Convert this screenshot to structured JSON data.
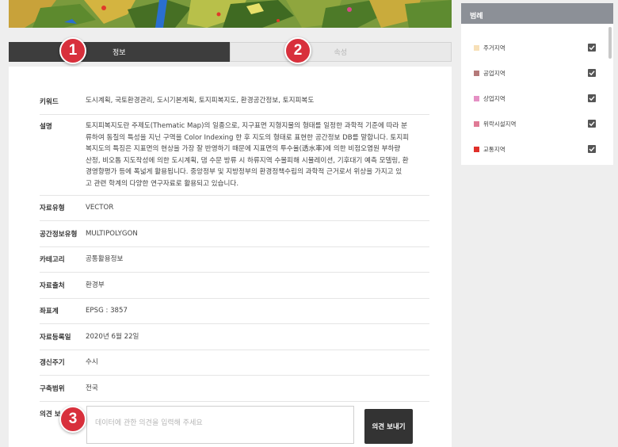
{
  "tabs": [
    {
      "label": "정보"
    },
    {
      "label": "속성"
    }
  ],
  "badges": [
    "1",
    "2",
    "3"
  ],
  "info": {
    "keyword": {
      "key": "키워드",
      "value": "도시계획, 국토환경관리, 도시기본계획, 토지피복지도, 환경공간정보, 토지피복도"
    },
    "description": {
      "key": "설명",
      "lines": [
        "토지피복지도란 주제도(Thematic Map)의 일종으로, 지구표면 지형지물의 형태를 일정한 과학적 기준에 따라 분",
        "류하여 동질의 특성을 지닌 구역을 Color Indexing 한 후 지도의 형태로 표현한 공간정보 DB를 말합니다. 토지피",
        "복지도의 특징은 지표면의 현상을 가장 잘 반영하기 때문에 지표면의 투수율(透水率)에 의한 비점오염원 부하량",
        "산정, 비오톱 지도작성에 의한 도시계획, 댐 수문 방류 시 하류지역 수몰피해 시뮬레이션, 기후대기 예측 모델링, 환",
        "경영향평가 등에 폭넓게 활용됩니다. 중앙정부 및 지방정부의 환경정책수립의 과학적 근거로서 위상을 가지고 있",
        "고 관련 학계의 다양한 연구자료로 활용되고 있습니다."
      ]
    },
    "data_type": {
      "key": "자료유형",
      "value": "VECTOR"
    },
    "geometry_type": {
      "key": "공간정보유형",
      "value": "MULTIPOLYGON"
    },
    "category": {
      "key": "카테고리",
      "value": "공통활용정보"
    },
    "source": {
      "key": "자료출처",
      "value": "환경부"
    },
    "crs": {
      "key": "좌표계",
      "value": "EPSG : 3857"
    },
    "registered": {
      "key": "자료등록일",
      "value": "2020년 6월 22일"
    },
    "update_cycle": {
      "key": "갱신주기",
      "value": "수시"
    },
    "coverage": {
      "key": "구축범위",
      "value": "전국"
    }
  },
  "opinion": {
    "label": "의견 보",
    "placeholder": "데이터에 관한 의견을 입력해 주세요",
    "send_label": "의견 보내기"
  },
  "legend": {
    "title": "범례",
    "items": [
      {
        "label": "주거지역",
        "color": "#f7e0b8",
        "checked": true
      },
      {
        "label": "공업지역",
        "color": "#b57a7a",
        "checked": true
      },
      {
        "label": "상업지역",
        "color": "#e590c4",
        "checked": true
      },
      {
        "label": "위락시설지역",
        "color": "#e07a96",
        "checked": true
      },
      {
        "label": "교통지역",
        "color": "#e0302a",
        "checked": true
      }
    ]
  },
  "colors": {
    "accent_badge": "#d8303c",
    "tab_active": "#3d3d3d",
    "legend_header": "#8c9097"
  }
}
